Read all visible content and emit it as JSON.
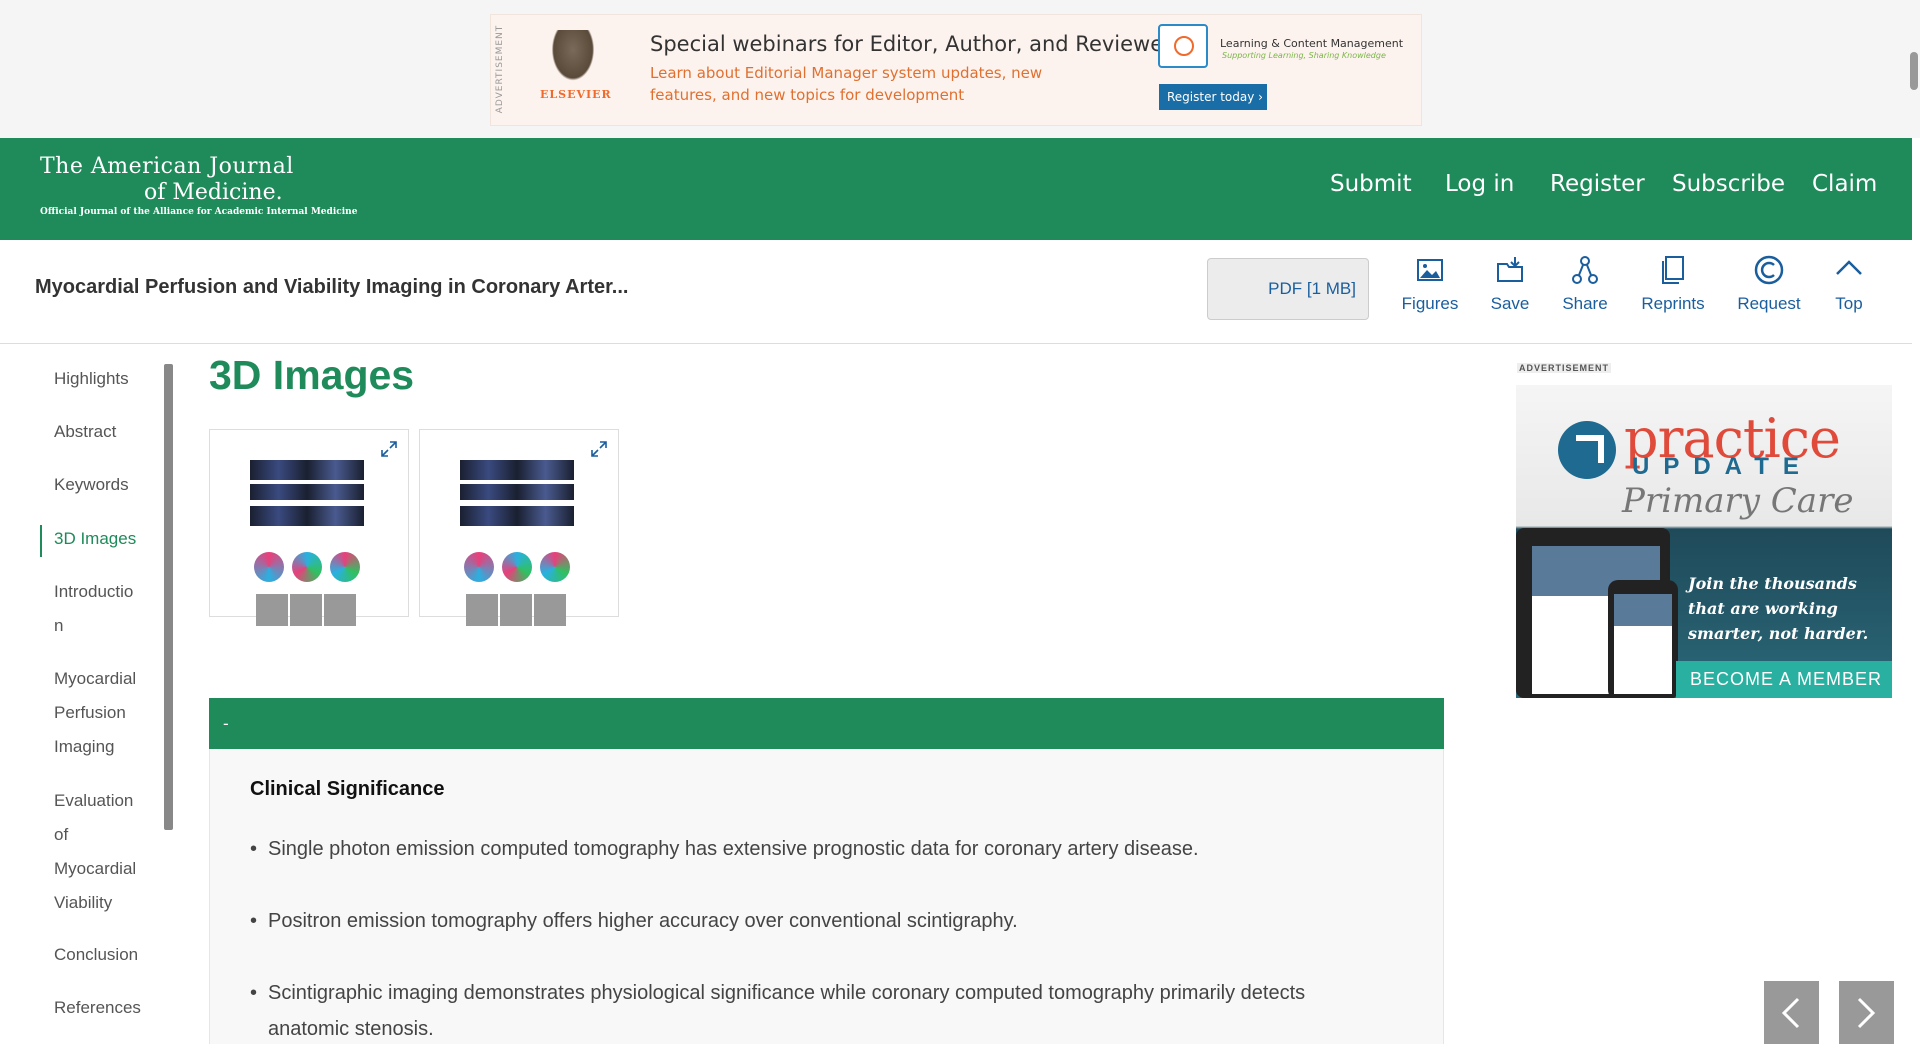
{
  "ad_banner": {
    "vertical_label": "ADVERTISEMENT",
    "publisher": "ELSEVIER",
    "title": "Special webinars for Editor, Author, and Reviewer",
    "description": "Learn about Editorial Manager system updates, new features, and new topics for development",
    "partner_title": "Learning & Content Management",
    "partner_subtitle": "Supporting Learning, Sharing Knowledge",
    "cta": "Register today ›"
  },
  "header": {
    "journal_line1": "The American Journal",
    "journal_line2": "of Medicine.",
    "journal_line3": "Official Journal of the Alliance for Academic Internal Medicine",
    "nav": [
      "Submit",
      "Log in",
      "Register",
      "Subscribe",
      "Claim"
    ]
  },
  "toolbar": {
    "article_title": "Myocardial Perfusion and Viability Imaging in Coronary Arter...",
    "pdf_label": "PDF [1 MB]",
    "tools": [
      {
        "label": "Figures",
        "icon": "image-icon"
      },
      {
        "label": "Save",
        "icon": "folder-save-icon"
      },
      {
        "label": "Share",
        "icon": "share-icon"
      },
      {
        "label": "Reprints",
        "icon": "reprints-icon"
      },
      {
        "label": "Request",
        "icon": "copyright-icon"
      },
      {
        "label": "Top",
        "icon": "chevron-up-icon"
      }
    ]
  },
  "section_nav": {
    "items": [
      {
        "label": "Highlights"
      },
      {
        "label": "Abstract"
      },
      {
        "label": "Keywords"
      },
      {
        "label": "3D Images",
        "active": true
      },
      {
        "label": "Introductio n"
      },
      {
        "label": "Myocardial Perfusion Imaging"
      },
      {
        "label": "Evaluation of Myocardial Viability"
      },
      {
        "label": "Conclusion"
      },
      {
        "label": "References"
      }
    ]
  },
  "main": {
    "heading": "3D Images",
    "clinical_bar": "-",
    "clinical_title": "Clinical Significance",
    "bullets": [
      "Single photon emission computed tomography has extensive prognostic data for coronary artery disease.",
      "Positron emission tomography offers higher accuracy over conventional scintigraphy.",
      "Scintigraphic imaging demonstrates physiological significance while coronary computed tomography primarily detects anatomic stenosis."
    ]
  },
  "side_ad": {
    "label": "ADVERTISEMENT",
    "brand": "practice",
    "brand_sub": "UPDATE",
    "specialty": "Primary Care",
    "tagline": "Join the thousands that are working smarter, not harder.",
    "cta": "BECOME A MEMBER"
  },
  "colors": {
    "brand_green": "#1f8a5a",
    "link_blue": "#1a5e9e"
  }
}
